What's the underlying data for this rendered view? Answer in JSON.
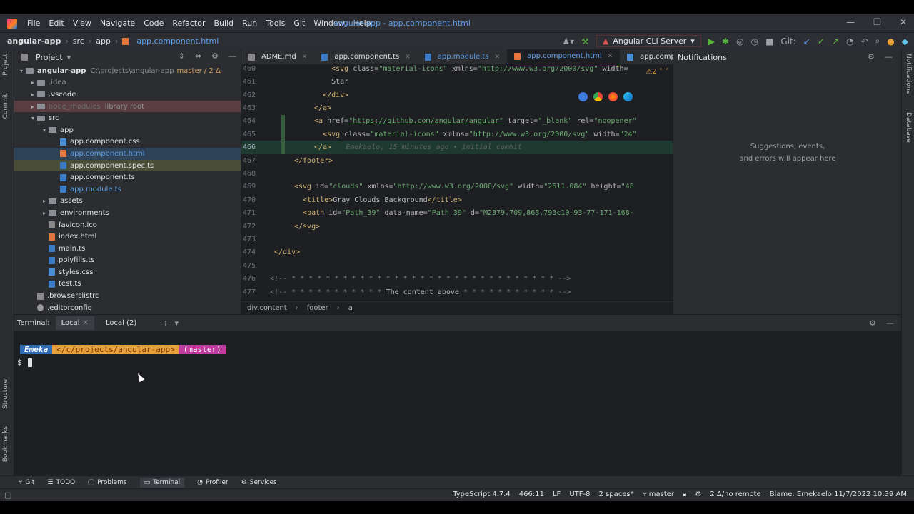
{
  "menubar": {
    "items": [
      "File",
      "Edit",
      "View",
      "Navigate",
      "Code",
      "Refactor",
      "Build",
      "Run",
      "Tools",
      "Git",
      "Window",
      "Help"
    ],
    "window_title": "angular-app - app.component.html",
    "controls": [
      "—",
      "❐",
      "✕"
    ]
  },
  "navbar": {
    "crumbs": [
      "angular-app",
      "src",
      "app",
      "app.component.html"
    ],
    "run_config": "Angular CLI Server",
    "git_label": "Git:"
  },
  "strips": {
    "left": [
      "Project",
      "Commit",
      "Structure",
      "Bookmarks"
    ],
    "right": [
      "Notifications",
      "Database"
    ]
  },
  "project": {
    "title": "Project",
    "tree": [
      {
        "indent": 0,
        "arrow": "▾",
        "icon": "folder",
        "label": "angular-app",
        "suffix": "C:\\projects\\angular-app",
        "branch": "master / 2 Δ",
        "style": "b"
      },
      {
        "indent": 1,
        "arrow": "▸",
        "icon": "folder",
        "label": ".idea",
        "style": "dim"
      },
      {
        "indent": 1,
        "arrow": "▸",
        "icon": "folder",
        "label": ".vscode"
      },
      {
        "indent": 1,
        "arrow": "▸",
        "icon": "folder",
        "label": "node_modules",
        "suffix": "library root",
        "row": "ignored"
      },
      {
        "indent": 1,
        "arrow": "▾",
        "icon": "folder",
        "label": "src"
      },
      {
        "indent": 2,
        "arrow": "▾",
        "icon": "folder",
        "label": "app"
      },
      {
        "indent": 3,
        "arrow": "",
        "icon": "css",
        "label": "app.component.css"
      },
      {
        "indent": 3,
        "arrow": "",
        "icon": "html",
        "label": "app.component.html",
        "style": "blue",
        "row": "sel"
      },
      {
        "indent": 3,
        "arrow": "",
        "icon": "ts",
        "label": "app.component.spec.ts",
        "row": "hl"
      },
      {
        "indent": 3,
        "arrow": "",
        "icon": "ts",
        "label": "app.component.ts"
      },
      {
        "indent": 3,
        "arrow": "",
        "icon": "ts",
        "label": "app.module.ts",
        "style": "blue"
      },
      {
        "indent": 2,
        "arrow": "▸",
        "icon": "folder",
        "label": "assets"
      },
      {
        "indent": 2,
        "arrow": "▸",
        "icon": "folder",
        "label": "environments"
      },
      {
        "indent": 2,
        "arrow": "",
        "icon": "gen",
        "label": "favicon.ico"
      },
      {
        "indent": 2,
        "arrow": "",
        "icon": "html",
        "label": "index.html"
      },
      {
        "indent": 2,
        "arrow": "",
        "icon": "ts",
        "label": "main.ts"
      },
      {
        "indent": 2,
        "arrow": "",
        "icon": "ts",
        "label": "polyfills.ts"
      },
      {
        "indent": 2,
        "arrow": "",
        "icon": "css",
        "label": "styles.css"
      },
      {
        "indent": 2,
        "arrow": "",
        "icon": "ts",
        "label": "test.ts"
      },
      {
        "indent": 1,
        "arrow": "",
        "icon": "gen",
        "label": ".browserslistrc"
      },
      {
        "indent": 1,
        "arrow": "",
        "icon": "cfg",
        "label": ".editorconfig"
      }
    ]
  },
  "editor": {
    "tabs": [
      {
        "label": "ADME.md",
        "active": false,
        "blue": false
      },
      {
        "label": "app.component.ts",
        "active": false,
        "blue": false
      },
      {
        "label": "app.module.ts",
        "active": false,
        "blue": true
      },
      {
        "label": "app.component.html",
        "active": true,
        "blue": true
      },
      {
        "label": "app.component.css",
        "active": false,
        "blue": false
      }
    ],
    "inspection": "⚠2 ˄ ˅",
    "lines": [
      {
        "n": "460",
        "html": "    <span class=\"tag\">&lt;svg</span> <span class=\"attr\">class=</span><span class=\"val\">\"material-icons\"</span> <span class=\"attr\">xmlns=</span><span class=\"val\">\"http://www.w3.org/2000/svg\"</span> <span class=\"attr\">width=</span>"
      },
      {
        "n": "461",
        "html": "    <span class=\"txt\">Star</span>"
      },
      {
        "n": "462",
        "html": "  <span class=\"tag\">&lt;/div&gt;</span>"
      },
      {
        "n": "463",
        "html": "<span class=\"tag\">&lt;/a&gt;</span>"
      },
      {
        "n": "464",
        "html": "<span class=\"tag\">&lt;a</span> <span class=\"attr\">href=</span><span class=\"url\">\"https://github.com/angular/angular\"</span> <span class=\"attr\">target=</span><span class=\"val\">\"_blank\"</span> <span class=\"attr\">rel=</span><span class=\"val\">\"noopener\"</span>"
      },
      {
        "n": "465",
        "html": "  <span class=\"tag\">&lt;svg</span> <span class=\"attr\">class=</span><span class=\"val\">\"material-icons\"</span> <span class=\"attr\">xmlns=</span><span class=\"val\">\"http://www.w3.org/2000/svg\"</span> <span class=\"attr\">width=</span><span class=\"val\">\"24\"</span>"
      },
      {
        "n": "466",
        "html": "<span class=\"tag\">&lt;/a&gt;</span><span class=\"blame\">Emekaelo, 15 minutes ago • initial commit</span>",
        "cur": true
      },
      {
        "n": "467",
        "html": "<span class=\"tag\">&lt;/footer&gt;</span>",
        "shift": -28
      },
      {
        "n": "468",
        "html": ""
      },
      {
        "n": "469",
        "html": "<span class=\"tag\">&lt;svg</span> <span class=\"attr\">id=</span><span class=\"val\">\"clouds\"</span> <span class=\"attr\">xmlns=</span><span class=\"val\">\"http://www.w3.org/2000/svg\"</span> <span class=\"attr\">width=</span><span class=\"val\">\"2611.084\"</span> <span class=\"attr\">height=</span><span class=\"val\">\"48</span>",
        "shift": -28
      },
      {
        "n": "470",
        "html": "  <span class=\"tag\">&lt;title&gt;</span><span class=\"txt\">Gray Clouds Background</span><span class=\"tag\">&lt;/title&gt;</span>",
        "shift": -28
      },
      {
        "n": "471",
        "html": "  <span class=\"tag\">&lt;path</span> <span class=\"attr\">id=</span><span class=\"val\">\"Path_39\"</span> <span class=\"attr\">data-name=</span><span class=\"val\">\"Path 39\"</span> <span class=\"attr\">d=</span><span class=\"val\">\"M2379.709,863.793c10-93-77-171-168-</span>",
        "shift": -28
      },
      {
        "n": "472",
        "html": "<span class=\"tag\">&lt;/svg&gt;</span>",
        "shift": -28
      },
      {
        "n": "473",
        "html": ""
      },
      {
        "n": "474",
        "html": "<span class=\"tag\">&lt;/div&gt;</span>",
        "shift": -56
      },
      {
        "n": "475",
        "html": ""
      },
      {
        "n": "476",
        "html": "<span class=\"cmt\">&lt;!-- * * * * * * * * * * * * * * * * * * * * * * * * * * * * * * * --&gt;</span>",
        "shift": -62
      },
      {
        "n": "477",
        "html": "<span class=\"cmt\">&lt;!-- * * * * * * * * * * *</span> <span class=\"txt\">The content above</span> <span class=\"cmt\">* * * * * * * * * * * --&gt;</span>",
        "shift": -62
      }
    ],
    "breadcrumbs": [
      "div.content",
      "footer",
      "a"
    ]
  },
  "notifications": {
    "title": "Notifications",
    "message_line1": "Suggestions, events,",
    "message_line2": "and errors will appear here"
  },
  "terminal": {
    "label": "Terminal:",
    "tabs": [
      "Local",
      "Local (2)"
    ],
    "prompt_user": "Emeka",
    "prompt_path": "</c/projects/angular-app>",
    "prompt_branch": "(master)",
    "prompt_symbol": "$"
  },
  "toolwindows": [
    "Git",
    "TODO",
    "Problems",
    "Terminal",
    "Profiler",
    "Services"
  ],
  "statusbar": {
    "items": [
      "TypeScript 4.7.4",
      "466:11",
      "LF",
      "UTF-8",
      "2 spaces*",
      "master",
      "2 Δ/no remote",
      "Blame: Emekaelo 11/7/2022 10:39 AM"
    ]
  },
  "colors": {
    "accent": "#3574f0",
    "file_blue": "#5e9ee8",
    "prompt_user_bg": "#2d6bb5",
    "prompt_path_bg": "#e8a13a",
    "prompt_branch_bg": "#c03aa0"
  }
}
